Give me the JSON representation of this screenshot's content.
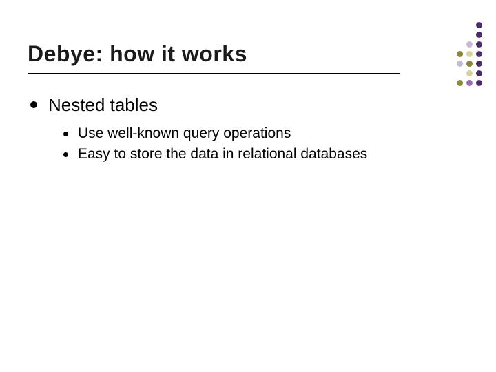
{
  "title": "Debye: how it works",
  "bullets": {
    "item1": {
      "text": "Nested tables",
      "sub1": "Use well-known query operations",
      "sub2": "Easy to store the data in relational databases"
    }
  },
  "deco_colors": {
    "purple": "#4b2a6b",
    "olive": "#8a8a3a",
    "lavender": "#c9b8da",
    "khaki": "#d3d1a0",
    "plum": "#9b72b0"
  }
}
